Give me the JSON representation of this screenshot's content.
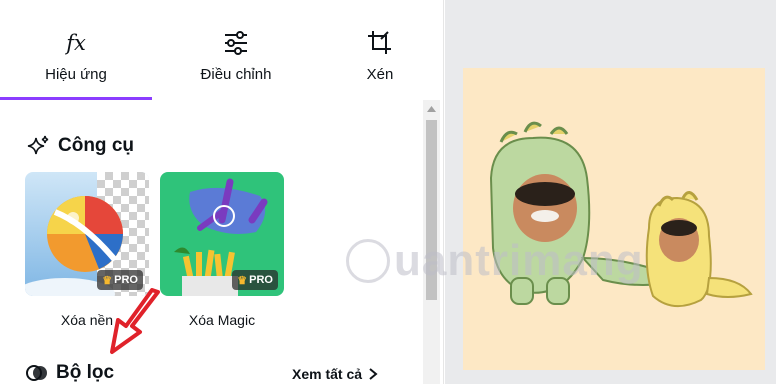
{
  "tabs": [
    {
      "label": "Hiệu ứng",
      "icon": "fx-icon"
    },
    {
      "label": "Điều chỉnh",
      "icon": "sliders-icon"
    },
    {
      "label": "Xén",
      "icon": "crop-icon"
    }
  ],
  "sections": {
    "tools": {
      "title": "Công cụ",
      "icon": "sparkles-icon"
    },
    "filters": {
      "title": "Bộ lọc",
      "icon": "filter-icon",
      "see_all": "Xem tất cả"
    }
  },
  "tools": [
    {
      "label": "Xóa nền",
      "badge": "PRO"
    },
    {
      "label": "Xóa Magic",
      "badge": "PRO"
    }
  ],
  "watermark": {
    "text": "uantrimang"
  },
  "colors": {
    "accent": "#8b3dff",
    "canvas_bg": "#fde8c5",
    "workspace_bg": "#e9eaec",
    "arrow": "#e0222a"
  }
}
